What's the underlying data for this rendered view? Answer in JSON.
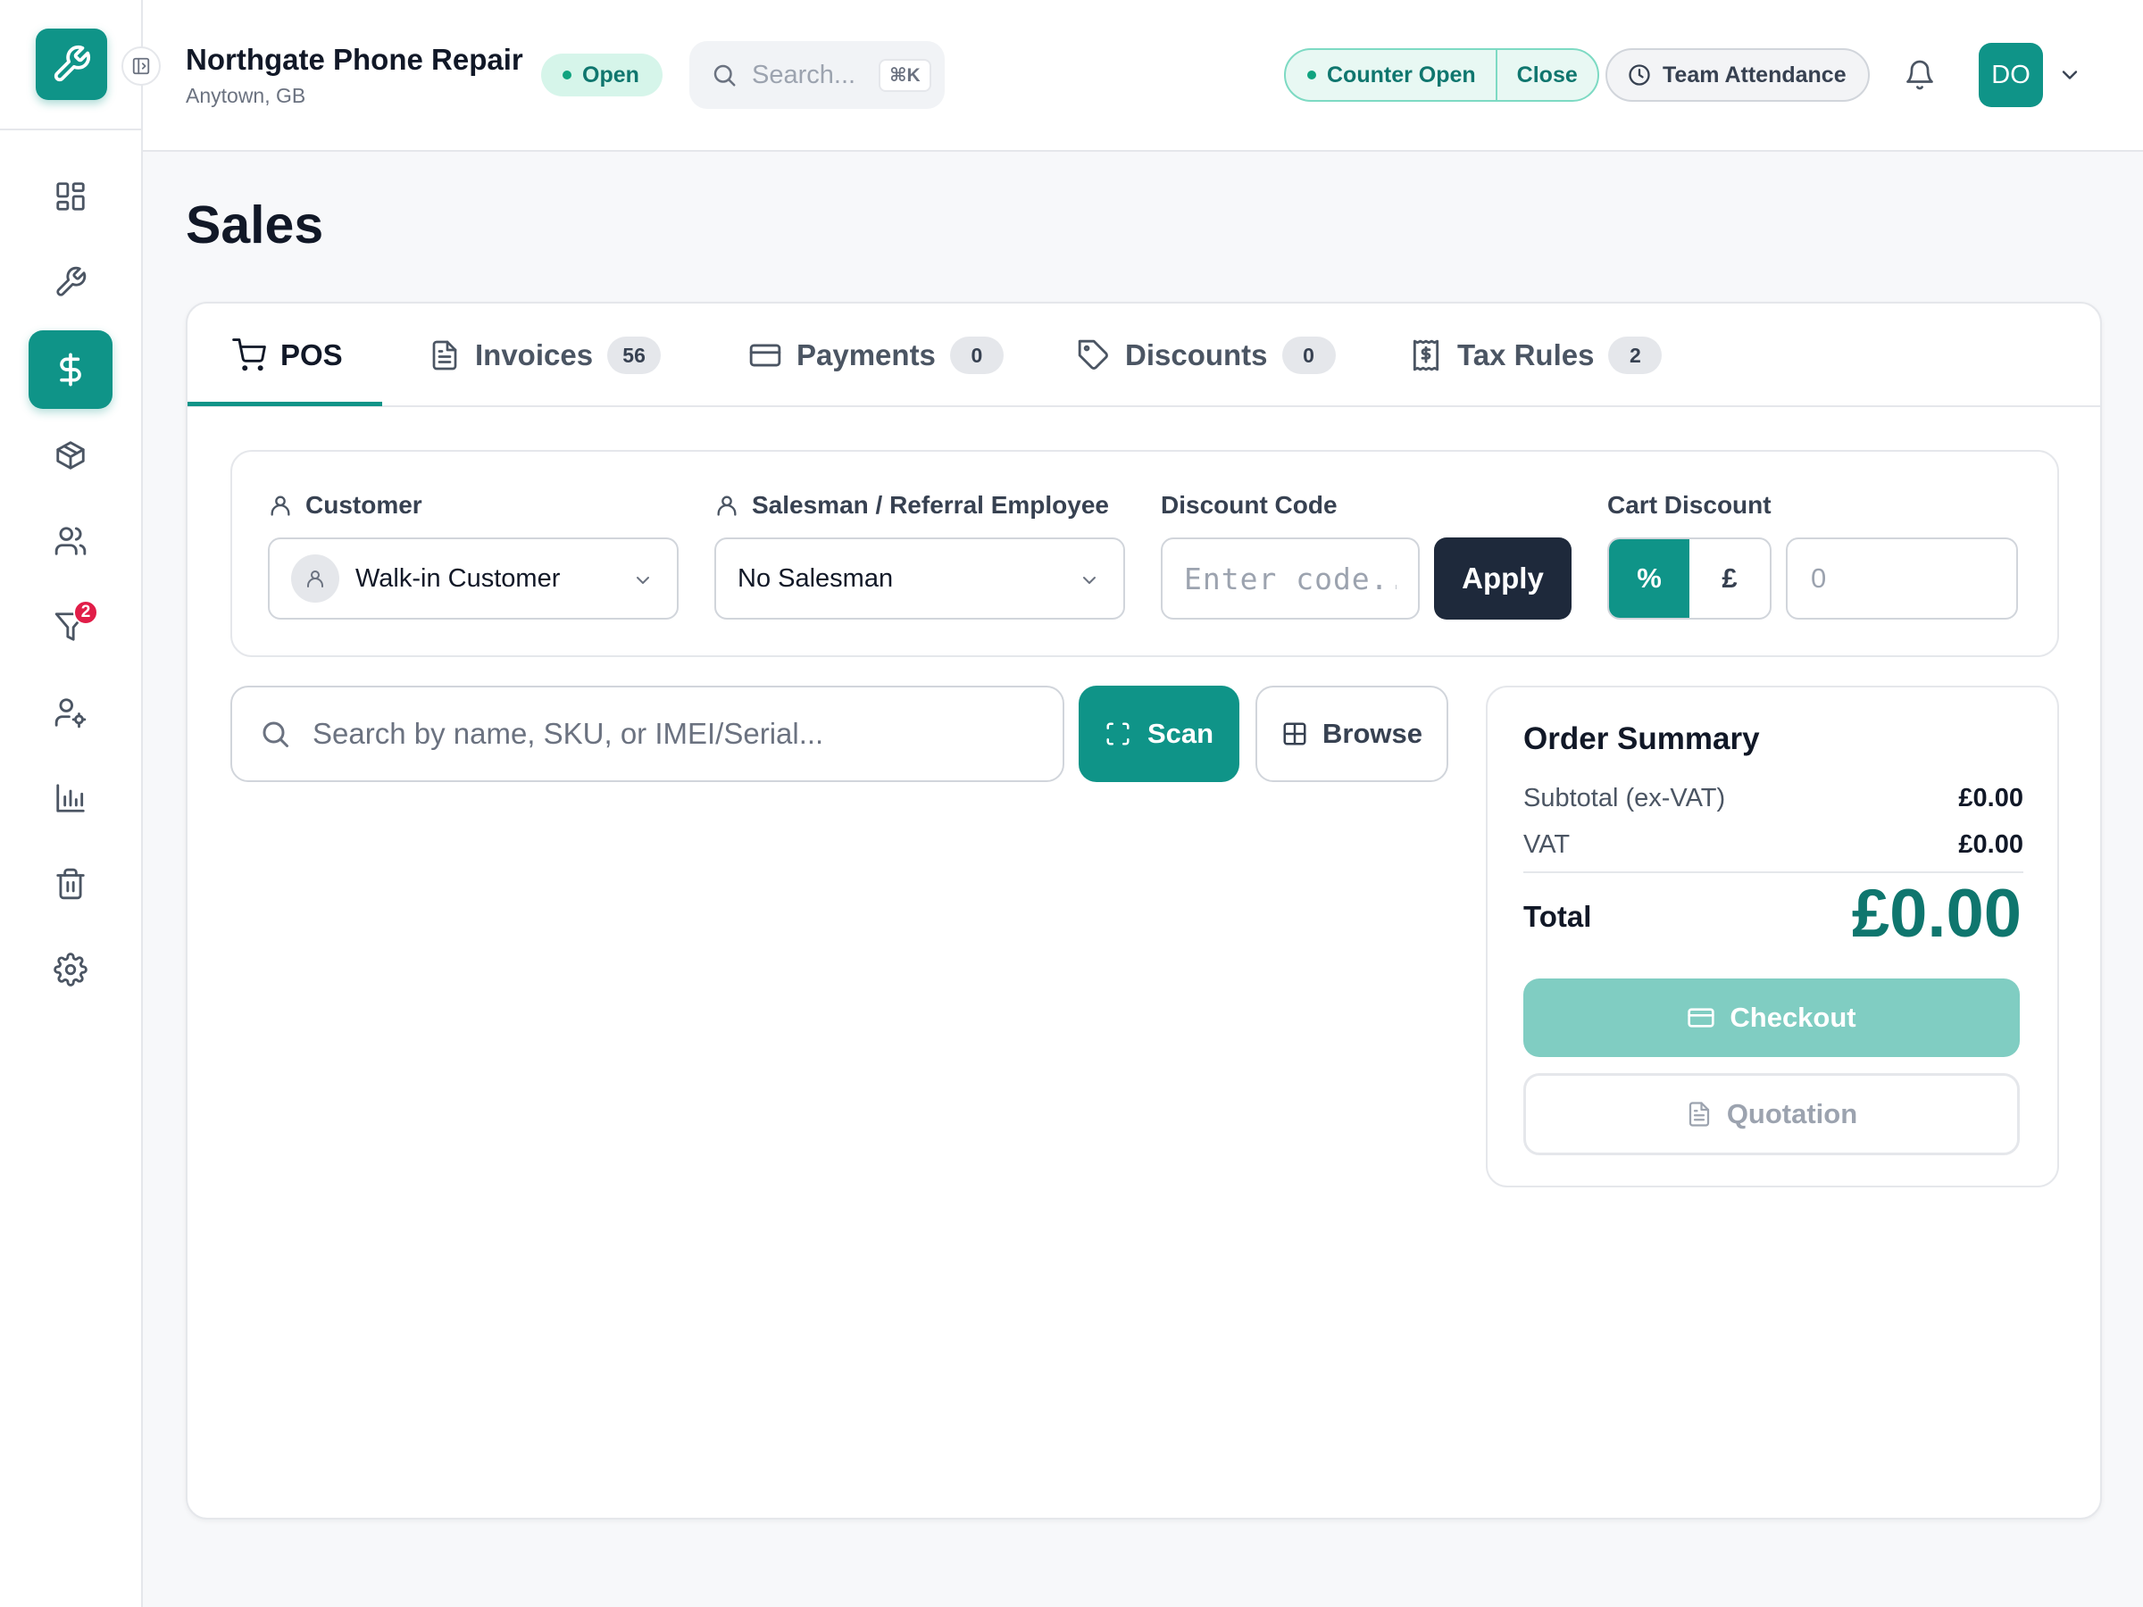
{
  "app": {
    "shop_name": "Northgate Phone Repair",
    "shop_location": "Anytown, GB",
    "status_label": "Open",
    "search_placeholder": "Search...",
    "search_shortcut": "⌘K",
    "counter_status": "Counter Open",
    "counter_close_label": "Close",
    "attendance_label": "Team Attendance",
    "user_initials": "DO",
    "brand_color": "#0f9488"
  },
  "sidebar": {
    "items": [
      {
        "name": "dashboard",
        "icon": "grid-icon",
        "active": false
      },
      {
        "name": "repairs",
        "icon": "wrench-icon",
        "active": false
      },
      {
        "name": "sales",
        "icon": "dollar-icon",
        "active": true
      },
      {
        "name": "inventory",
        "icon": "box-icon",
        "active": false
      },
      {
        "name": "customers",
        "icon": "users-icon",
        "active": false
      },
      {
        "name": "leads",
        "icon": "funnel-icon",
        "active": false,
        "badge": "2"
      },
      {
        "name": "team",
        "icon": "user-gear-icon",
        "active": false
      },
      {
        "name": "reports",
        "icon": "bar-chart-icon",
        "active": false
      },
      {
        "name": "trash",
        "icon": "trash-icon",
        "active": false
      },
      {
        "name": "settings",
        "icon": "gear-icon",
        "active": false
      }
    ]
  },
  "page": {
    "title": "Sales"
  },
  "tabs": [
    {
      "label": "POS",
      "count": null,
      "icon": "cart-icon",
      "active": true
    },
    {
      "label": "Invoices",
      "count": "56",
      "icon": "document-icon"
    },
    {
      "label": "Payments",
      "count": "0",
      "icon": "card-icon"
    },
    {
      "label": "Discounts",
      "count": "0",
      "icon": "tag-icon"
    },
    {
      "label": "Tax Rules",
      "count": "2",
      "icon": "receipt-icon"
    }
  ],
  "filters": {
    "customer_label": "Customer",
    "customer_value": "Walk-in Customer",
    "salesman_label": "Salesman / Referral Employee",
    "salesman_value": "No Salesman",
    "discount_code_label": "Discount Code",
    "discount_code_placeholder": "Enter code...",
    "apply_label": "Apply",
    "cart_discount_label": "Cart Discount",
    "percent_symbol": "%",
    "currency_symbol": "£",
    "cart_discount_placeholder": "0",
    "cart_discount_mode": "percent"
  },
  "product_search": {
    "placeholder": "Search by name, SKU, or IMEI/Serial...",
    "scan_label": "Scan",
    "browse_label": "Browse"
  },
  "order_summary": {
    "title": "Order Summary",
    "subtotal_label": "Subtotal (ex-VAT)",
    "subtotal_value": "£0.00",
    "vat_label": "VAT",
    "vat_value": "£0.00",
    "total_label": "Total",
    "total_value": "£0.00",
    "checkout_label": "Checkout",
    "quotation_label": "Quotation"
  }
}
